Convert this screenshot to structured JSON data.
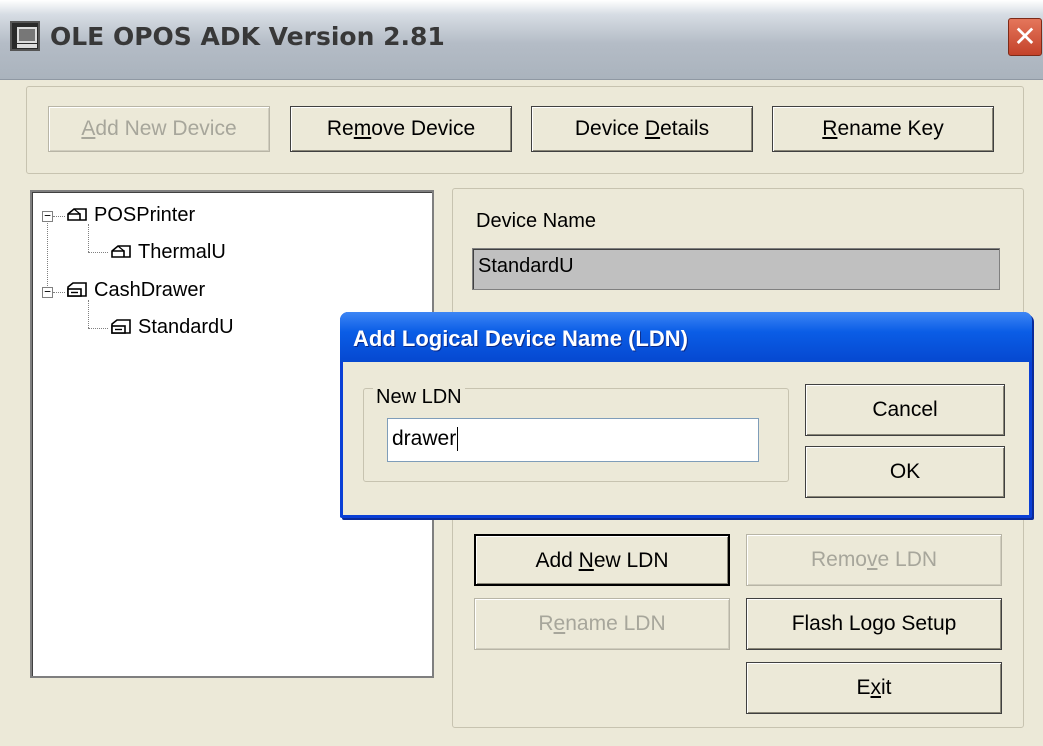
{
  "window": {
    "title": "OLE OPOS ADK Version 2.81",
    "close_label": "✕"
  },
  "toolbar": {
    "add_device_pre": "",
    "add_device_key": "A",
    "add_device_post": "dd New Device",
    "remove_device_pre": "Re",
    "remove_device_key": "m",
    "remove_device_post": "ove Device",
    "device_details_pre": "Device ",
    "device_details_key": "D",
    "device_details_post": "etails",
    "rename_key_pre": "",
    "rename_key_key": "R",
    "rename_key_post": "ename Key"
  },
  "tree": {
    "items": [
      {
        "label": "POSPrinter",
        "expander": "−"
      },
      {
        "label": "ThermalU"
      },
      {
        "label": "CashDrawer",
        "expander": "−"
      },
      {
        "label": "StandardU"
      }
    ]
  },
  "details": {
    "device_name_label": "Device Name",
    "device_name_value": "StandardU"
  },
  "actions": {
    "add_ldn_pre": "Add ",
    "add_ldn_key": "N",
    "add_ldn_post": "ew LDN",
    "remove_ldn_pre": "Remo",
    "remove_ldn_key": "v",
    "remove_ldn_post": "e LDN",
    "rename_ldn_pre": "R",
    "rename_ldn_key": "e",
    "rename_ldn_post": "name LDN",
    "flash_logo_label": "Flash Logo Setup",
    "exit_pre": "E",
    "exit_key": "x",
    "exit_post": "it"
  },
  "dialog": {
    "title": "Add Logical Device Name (LDN)",
    "group_label": "New LDN",
    "input_value": "drawer",
    "cancel_label": "Cancel",
    "ok_label": "OK"
  },
  "colors": {
    "window_bg": "#ece9d8",
    "dialog_title_blue": "#0a5de6",
    "close_red": "#c4422a",
    "disabled_text": "#a7a69b"
  }
}
